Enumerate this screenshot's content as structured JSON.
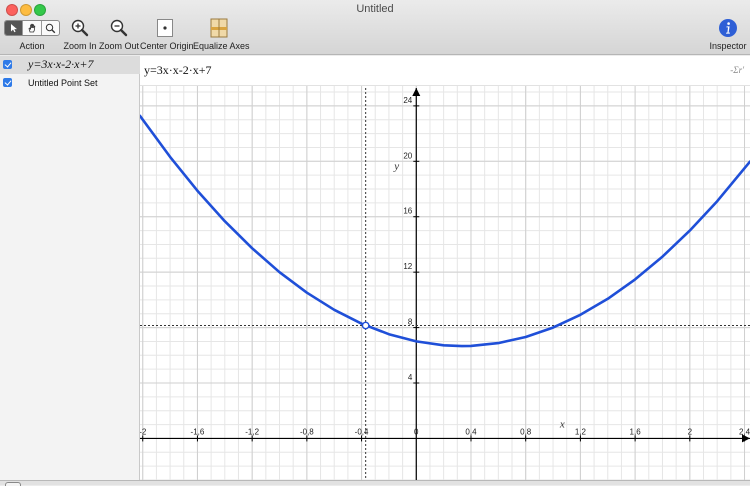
{
  "window": {
    "title": "Untitled"
  },
  "toolbar": {
    "action_label": "Action",
    "zoom_in_label": "Zoom In",
    "zoom_out_label": "Zoom Out",
    "center_origin_label": "Center Origin",
    "equalize_axes_label": "Equalize Axes",
    "inspector_label": "Inspector",
    "accent_color": "#2e7ae8"
  },
  "sidebar": {
    "items": [
      {
        "label": "y=3x·x-2·x+7",
        "checked": true,
        "selected": true
      },
      {
        "label": "Untitled Point Set",
        "checked": true,
        "selected": false
      }
    ]
  },
  "graph": {
    "equation_text": "y=3x·x-2·x+7",
    "side_label": "-Σr'",
    "curve_color": "#1f4fd8"
  },
  "chart_data": {
    "type": "line",
    "function": "y = 3x^2 - 2x + 7",
    "xlabel": "x",
    "ylabel": "y",
    "xlim": [
      -2.02,
      2.44
    ],
    "ylim": [
      -3.0,
      27.6
    ],
    "x_ticks": [
      -2,
      -1.6,
      -1.2,
      -0.8,
      -0.4,
      0,
      0.4,
      0.8,
      1.2,
      1.6,
      2,
      2.4
    ],
    "x_tick_labels": [
      "-2",
      "-1,6",
      "-1,2",
      "-0,8",
      "-0,4",
      "0",
      "0,4",
      "0,8",
      "1,2",
      "1,6",
      "2",
      "2,4"
    ],
    "y_ticks": [
      4,
      8,
      12,
      16,
      20,
      24
    ],
    "y_tick_labels": [
      "4",
      "8",
      "12",
      "16",
      "20",
      "24"
    ],
    "grid": true,
    "series": [
      {
        "x": [
          -2.02,
          -1.8,
          -1.6,
          -1.4,
          -1.2,
          -1.0,
          -0.8,
          -0.6,
          -0.4,
          -0.2,
          0.0,
          0.2,
          0.333,
          0.4,
          0.6,
          0.8,
          1.0,
          1.2,
          1.4,
          1.6,
          1.8,
          2.0,
          2.2,
          2.44
        ],
        "y": [
          23.28,
          20.32,
          17.88,
          15.68,
          13.72,
          12.0,
          10.52,
          9.28,
          8.28,
          7.52,
          7.0,
          6.72,
          6.667,
          6.68,
          6.88,
          7.32,
          8.0,
          8.92,
          10.08,
          11.48,
          13.12,
          15.0,
          17.12,
          19.98
        ]
      }
    ],
    "marked_point": {
      "x": -0.37,
      "y": 8.15
    },
    "guide_lines": {
      "vertical_x": -0.37,
      "horizontal_y": 8.15
    }
  }
}
